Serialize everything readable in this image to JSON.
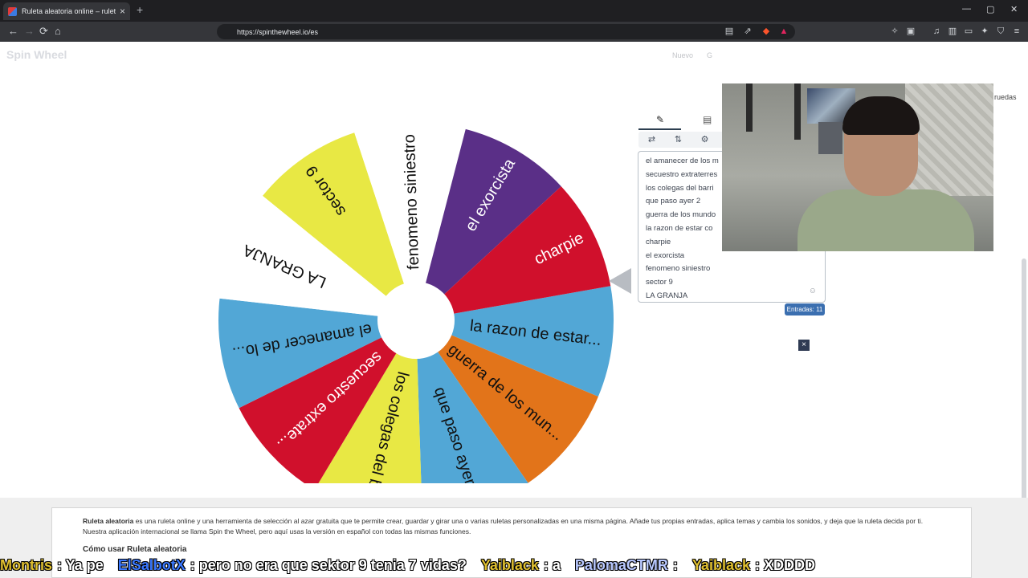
{
  "browser": {
    "tab_title": "Ruleta aleatoria online – rulet",
    "tab_close": "×",
    "new_tab": "+",
    "url": "https://spinthewheel.io/es",
    "win_min": "—",
    "win_max": "▢",
    "win_close": "✕",
    "back": "←",
    "forward": "→",
    "reload": "⟳",
    "home": "⌂"
  },
  "page": {
    "logo": "Spin Wheel",
    "menu_nuevo": "Nuevo",
    "menu_partial": "G",
    "tiros_partial": "ruedas"
  },
  "wheel": {
    "segments": [
      {
        "label": "la razon de estar...",
        "color": "#52a7d6"
      },
      {
        "label": "guerra de los mun...",
        "color": "#e2741a"
      },
      {
        "label": "que paso ayer 2",
        "color": "#52a7d6"
      },
      {
        "label": "los colegas del b...",
        "color": "#e8e844"
      },
      {
        "label": "secuestro extrate...",
        "color": "#d0102c"
      },
      {
        "label": "el amanecer de lo...",
        "color": "#52a7d6"
      },
      {
        "label": "LA GRANJA",
        "color": "#ffffff"
      },
      {
        "label": "sector 9",
        "color": "#e8e844"
      },
      {
        "label": "fenomeno siniestro",
        "color": "#ffffff"
      },
      {
        "label": "el exorcista",
        "color": "#5a2f87"
      },
      {
        "label": "charpie",
        "color": "#d0102c"
      }
    ]
  },
  "editor": {
    "tab_icons": [
      "pencil-icon",
      "clipboard-icon"
    ],
    "tool_icons": [
      "shuffle-icon",
      "sort-icon",
      "settings-icon"
    ],
    "entries": [
      "el amanecer de los m",
      "secuestro extraterres",
      "los colegas del barri",
      "que paso ayer 2",
      "guerra de los mundo",
      "la razon de estar co",
      "charpie",
      "el exorcista",
      "fenomeno siniestro",
      "sector 9",
      "LA GRANJA"
    ],
    "entries_count": "Entradas: 11",
    "close_label": "×",
    "smiley": "☺"
  },
  "info": {
    "bold_lead": "Ruleta aleatoria",
    "text": " es una ruleta online y una herramienta de selección al azar gratuita que te permite crear, guardar y girar una o varias ruletas personalizadas en una misma página. Añade tus propias entradas, aplica temas y cambia los sonidos, y deja que la ruleta decida por ti. Nuestra aplicación internacional se llama Spin the Wheel, pero aquí usas la versión en español con todas las mismas funciones.",
    "heading_partial": "Cómo usar Ruleta aleatoria"
  },
  "chat": [
    {
      "user": "Montris",
      "color": "#e0c030",
      "msg": ": Ya pe"
    },
    {
      "user": "ElSalbotX",
      "color": "#3a78ff",
      "msg": ": pero no era que sektor 9 tenia 7 vidas?"
    },
    {
      "user": "Yaiblack",
      "color": "#e0c030",
      "msg": ": a"
    },
    {
      "user": "PalomaCTMR",
      "color": "#b8c8ff",
      "msg": ":"
    },
    {
      "user": "Yaiblack",
      "color": "#e0c030",
      "msg": ": XDDDD"
    }
  ],
  "colors": {
    "pointer": "#b8bcc2",
    "badge": "#3b6fb0"
  }
}
